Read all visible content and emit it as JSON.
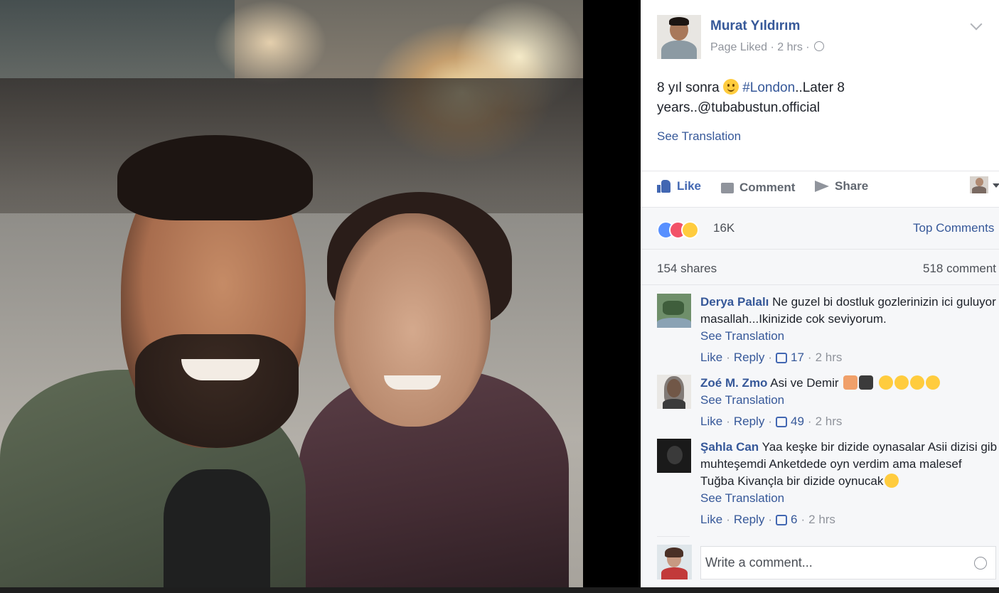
{
  "post": {
    "author": "Murat Yıldırım",
    "meta": "Page Liked · 2 hrs ·",
    "text_before": "8 yıl sonra ",
    "hashtag": "#London",
    "text_after": "..Later 8 years..@tubabustun.official",
    "see_translation": "See Translation"
  },
  "actions": {
    "like": "Like",
    "comment": "Comment",
    "share": "Share"
  },
  "summary": {
    "reaction_count": "16K",
    "top_comments": "Top Comments",
    "shares": "154 shares",
    "comments": "518 comment"
  },
  "comments": [
    {
      "author": "Derya Palalı",
      "text": " Ne guzel bi dostluk gozlerinizin ici guluyor masallah...Ikinizide cok seviyorum.",
      "see_translation": "See Translation",
      "like": "Like",
      "reply": "Reply",
      "likes": "17",
      "time": "2 hrs"
    },
    {
      "author": "Zoé M. Zmo",
      "text": " Asi ve Demir ",
      "see_translation": "See Translation",
      "like": "Like",
      "reply": "Reply",
      "likes": "49",
      "time": "2 hrs"
    },
    {
      "author": "Şahla Can",
      "text": " Yaa keşke bir dizide oynasalar Asii dizisi gib muhteşemdi Anketdede oyn verdim ama malesef Tuğba Kivançla bir dizide oynucak",
      "see_translation": "See Translation",
      "like": "Like",
      "reply": "Reply",
      "likes": "6",
      "time": "2 hrs"
    }
  ],
  "composer": {
    "placeholder": "Write a comment..."
  },
  "colors": {
    "link": "#365899",
    "like_blue": "#4267b2",
    "muted": "#90949c",
    "summary_bg": "#f6f7f9"
  }
}
